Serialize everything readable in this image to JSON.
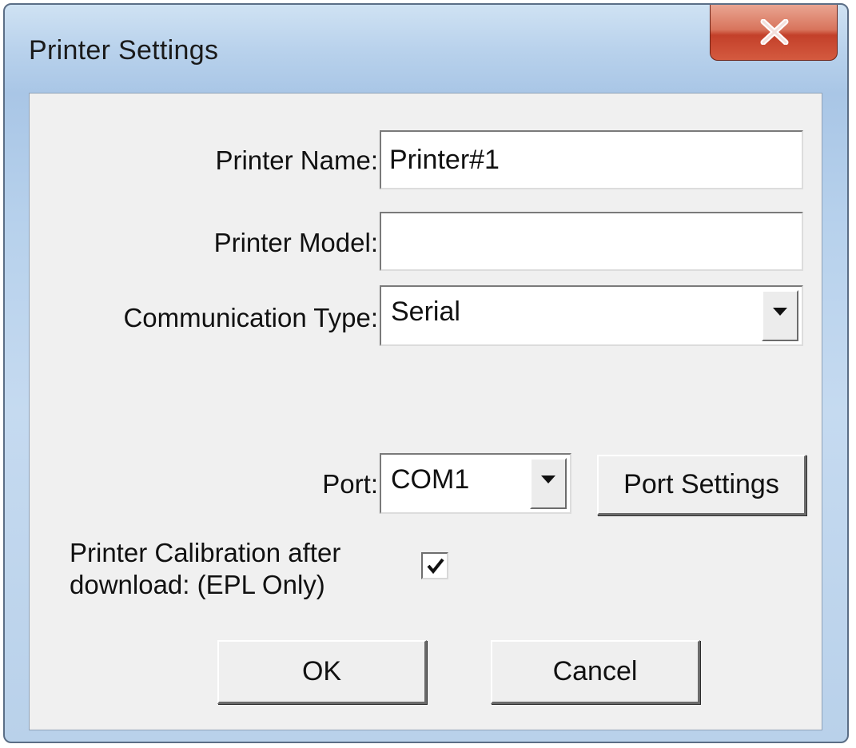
{
  "window": {
    "title": "Printer Settings",
    "close_icon": "close-x-icon"
  },
  "form": {
    "printer_name": {
      "label": "Printer Name:",
      "value": "Printer#1"
    },
    "printer_model": {
      "label": "Printer Model:",
      "value": ""
    },
    "communication_type": {
      "label": "Communication Type:",
      "selected": "Serial"
    },
    "port": {
      "label": "Port:",
      "selected": "COM1",
      "settings_button": "Port Settings"
    },
    "calibration": {
      "label_line1": "Printer Calibration after",
      "label_line2": "download: (EPL Only)",
      "checked": true
    }
  },
  "buttons": {
    "ok": "OK",
    "cancel": "Cancel"
  },
  "colors": {
    "close_button": "#c3402a",
    "dialog_background": "#f0f0f0",
    "frame": "#b9d2ec"
  }
}
